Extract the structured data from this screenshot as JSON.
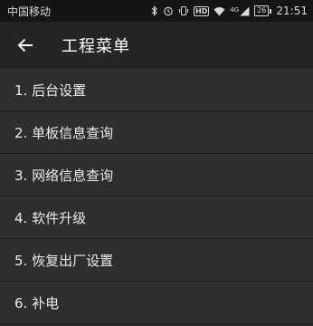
{
  "status_bar": {
    "carrier": "中国移动",
    "network": "4G",
    "battery": "26",
    "time": "21:51",
    "icons": [
      "bluetooth-icon",
      "alarm-icon",
      "vibrate-icon",
      "hd-icon",
      "wifi-icon",
      "signal-icon",
      "battery-icon"
    ]
  },
  "app_bar": {
    "back_icon": "arrow-left-icon",
    "title": "工程菜单"
  },
  "menu": {
    "items": [
      {
        "label": "1. 后台设置"
      },
      {
        "label": "2. 单板信息查询"
      },
      {
        "label": "3. 网络信息查询"
      },
      {
        "label": "4. 软件升级"
      },
      {
        "label": "5. 恢复出厂设置"
      },
      {
        "label": "6. 补电"
      }
    ]
  },
  "colors": {
    "status_bar_bg": "#151515",
    "app_bar_bg": "#252525",
    "list_bg": "#2e2e2e",
    "divider": "#1a1a1a",
    "text": "#ececec"
  }
}
